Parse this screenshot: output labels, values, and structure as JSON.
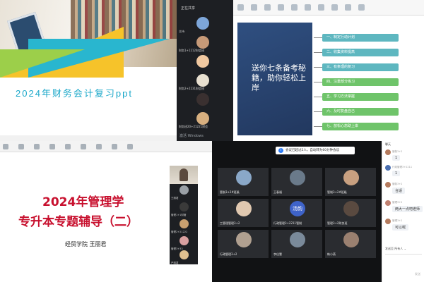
{
  "top_left": {
    "slide_title": "2024年财务会计复习ppt",
    "meeting_header": "正在共享",
    "participants": [
      {
        "name": "主持"
      },
      {
        "name": "财务1+1212财会班"
      },
      {
        "name": ""
      },
      {
        "name": "财务2+2231财会班"
      },
      {
        "name": ""
      },
      {
        "name": "财务班20+21221财会"
      }
    ],
    "watermark": "激活 Windows"
  },
  "top_right": {
    "box_text": "送你七条备考秘籍，助你轻松上岸",
    "items": [
      {
        "label": "一、制定行动计划",
        "tone": "teal"
      },
      {
        "label": "二、收集资料提高"
      },
      {
        "label": "三、有条理的复习"
      },
      {
        "label": "四、注重部分练习"
      },
      {
        "label": "五、学习方法掌握"
      },
      {
        "label": "六、及时复盘自己"
      },
      {
        "label": "七、放松心态助上岸"
      }
    ]
  },
  "bottom_left": {
    "title_line1": "2024年管理学",
    "title_line2": "专升本专题辅导（二）",
    "author": "经贸学院 王丽君",
    "meeting_rows": [
      {
        "name": "王丽君"
      },
      {
        "name": "管理1+1财管"
      },
      {
        "name": "管理2+21222"
      },
      {
        "name": "管理3+33"
      },
      {
        "name": "严丽君"
      }
    ]
  },
  "bottom_mid": {
    "notice": "会议已超过2人，自动转为60分钟会议",
    "tiles": [
      {
        "name": "管制3+2#班级",
        "avatar": ""
      },
      {
        "name": "王春福",
        "avatar": ""
      },
      {
        "name": "管制3+2#班级",
        "avatar": ""
      },
      {
        "name": "工管理管理3+2",
        "avatar": ""
      },
      {
        "name": "行政管理3+2211管制",
        "avatar": "汤韵"
      },
      {
        "name": "管理3+2财务班",
        "avatar": ""
      },
      {
        "name": "行政管理3+2",
        "avatar": ""
      },
      {
        "name": "李佳慧",
        "avatar": ""
      },
      {
        "name": "韩小燕",
        "avatar": ""
      }
    ]
  },
  "chat": {
    "header": "聊天",
    "messages": [
      {
        "meta": "管制3+2",
        "text": "1"
      },
      {
        "meta": "行政管理3+2211",
        "text": "1"
      },
      {
        "meta": "管制3+2",
        "text": "合适"
      },
      {
        "meta": "管理3+2",
        "text": "两大一点吧老师"
      },
      {
        "meta": "管理3+2",
        "text": "可以呢"
      }
    ],
    "send_to_label": "发送至",
    "send_to_value": "所有人",
    "send_button": "发送"
  }
}
